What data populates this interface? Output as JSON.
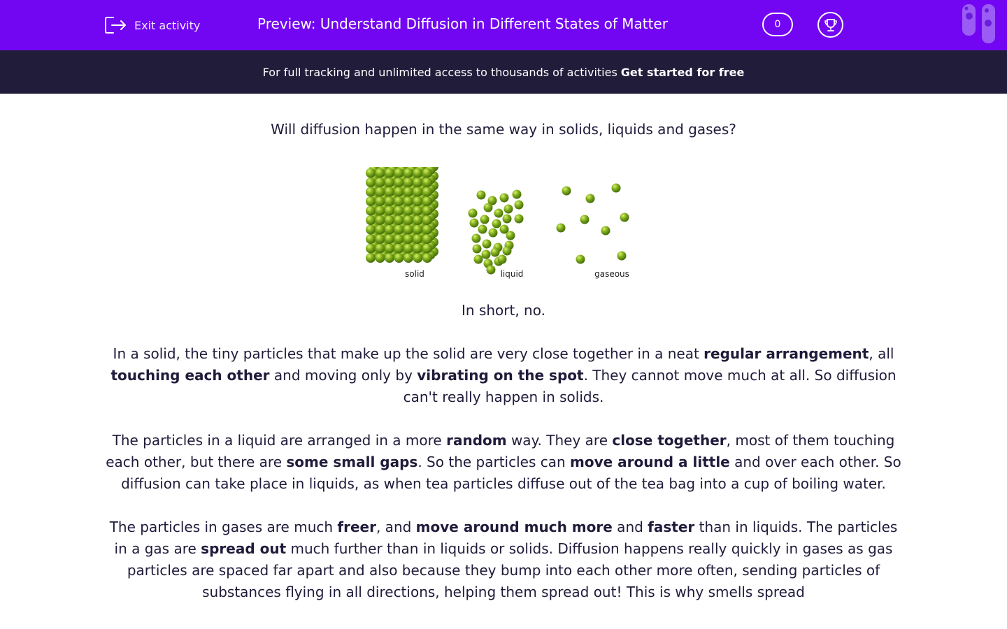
{
  "header": {
    "exit_label": "Exit activity",
    "title": "Preview: Understand Diffusion in Different States of Matter",
    "score": "0",
    "brand_color": "#7306f2"
  },
  "banner": {
    "text": "For full tracking and unlimited access to thousands of activities",
    "cta": "Get started for free"
  },
  "question": "Will diffusion happen in the same way in solids, liquids and gases?",
  "figure": {
    "labels": {
      "solid": "solid",
      "liquid": "liquid",
      "gaseous": "gaseous"
    },
    "particle_color": "#6b9a16"
  },
  "answer": {
    "short": "In short, no.",
    "p1": {
      "t1": "In a solid, the tiny particles that make up the solid are very close together in a neat ",
      "b1": "regular arrangement",
      "t2": ", all ",
      "b2": "touching each other",
      "t3": " and moving only by ",
      "b3": "vibrating on the spot",
      "t4": ". They cannot move much at all. So diffusion can't really happen in solids."
    },
    "p2": {
      "t1": "The particles in a liquid are arranged in a more ",
      "b1": "random",
      "t2": " way. They are ",
      "b2": "close together",
      "t3": ", most of them touching each other, but there are ",
      "b3": "some small gaps",
      "t4": ". So the particles can ",
      "b4": "move around a little",
      "t5": " and over each other. So diffusion can take place in liquids, as when tea particles diffuse out of the tea bag into a cup of boiling water."
    },
    "p3": {
      "t1": "The particles in gases are much ",
      "b1": "freer",
      "t2": ", and ",
      "b2": "move around much more",
      "t3": " and ",
      "b3": "faster",
      "t4": " than in liquids. The particles in a gas are ",
      "b4": "spread out",
      "t5": " much further than in liquids or solids. Diffusion happens really quickly in gases as gas particles are spaced far apart and also because they bump into each other more often, sending particles of substances flying in all directions, helping them spread out! This is why smells spread"
    }
  }
}
